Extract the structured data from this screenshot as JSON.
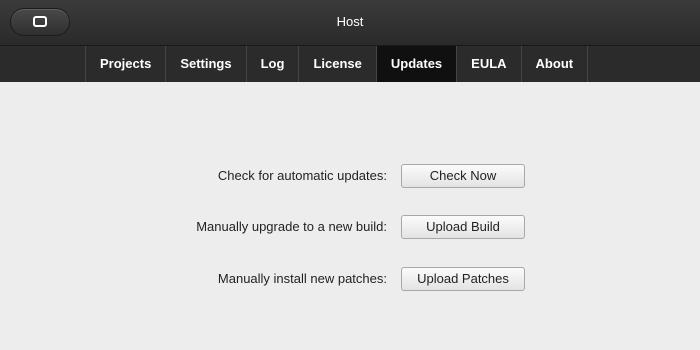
{
  "window": {
    "title": "Host",
    "window_button_icon": "window-restore-icon"
  },
  "tabs": [
    {
      "label": "Projects",
      "active": false
    },
    {
      "label": "Settings",
      "active": false
    },
    {
      "label": "Log",
      "active": false
    },
    {
      "label": "License",
      "active": false
    },
    {
      "label": "Updates",
      "active": true
    },
    {
      "label": "EULA",
      "active": false
    },
    {
      "label": "About",
      "active": false
    }
  ],
  "updates": {
    "check": {
      "label": "Check for automatic updates:",
      "button": "Check Now"
    },
    "upgrade": {
      "label": "Manually upgrade to a new build:",
      "button": "Upload Build"
    },
    "patches": {
      "label": "Manually install new patches:",
      "button": "Upload Patches"
    }
  },
  "colors": {
    "titlebar": "#2f2f2f",
    "tabbar": "#2b2b2b",
    "active_tab": "#101010",
    "content_bg": "#ededed"
  }
}
